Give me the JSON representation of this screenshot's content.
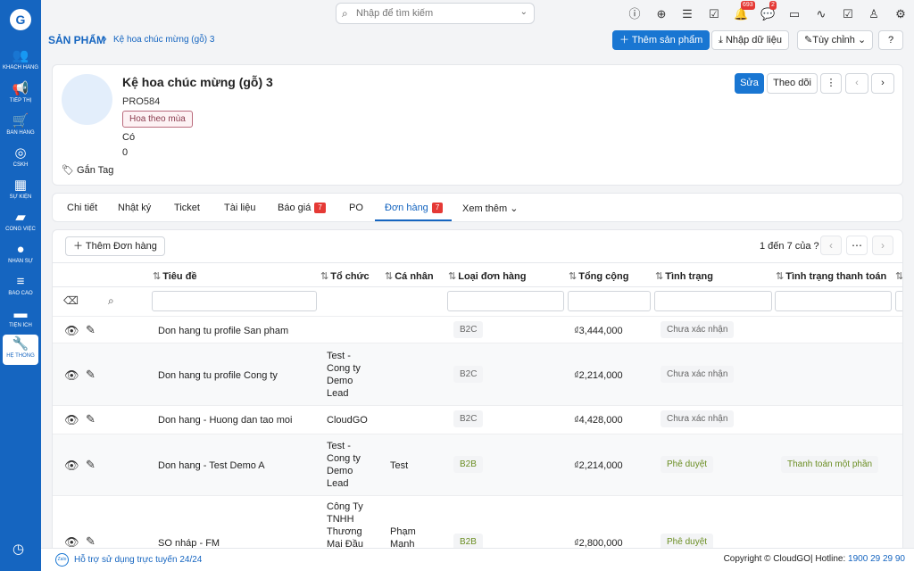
{
  "sidebar": {
    "logo": "G",
    "items": [
      {
        "label": "KHÁCH HÀNG",
        "icon": "users-icon",
        "glyph": "👥"
      },
      {
        "label": "TIẾP THỊ",
        "icon": "megaphone-icon",
        "glyph": "📢"
      },
      {
        "label": "BÁN HÀNG",
        "icon": "cart-icon",
        "glyph": "🛒"
      },
      {
        "label": "CSKH",
        "icon": "support-icon",
        "glyph": "◎"
      },
      {
        "label": "SỰ KIỆN",
        "icon": "calendar-icon",
        "glyph": "▦"
      },
      {
        "label": "CÔNG VIỆC",
        "icon": "briefcase-icon",
        "glyph": "▰"
      },
      {
        "label": "NHÂN SỰ",
        "icon": "person-icon",
        "glyph": "●"
      },
      {
        "label": "BÁO CÁO",
        "icon": "report-icon",
        "glyph": "≡"
      },
      {
        "label": "TIỆN ÍCH",
        "icon": "utility-icon",
        "glyph": "▬"
      },
      {
        "label": "HỆ THỐNG",
        "icon": "wrench-icon",
        "glyph": "🔧"
      }
    ]
  },
  "search": {
    "placeholder": "Nhập để tìm kiếm"
  },
  "topbar": {
    "notifications_badge": "693",
    "messages_badge": "2"
  },
  "breadcrumb": {
    "root": "Sản phẩm",
    "separator": "›",
    "current": "Kệ hoa chúc mừng (gỗ) 3"
  },
  "header_actions": {
    "add_product": "Thêm sản phẩm",
    "import": "Nhập dữ liệu",
    "customize": "Tùy chỉnh",
    "help": "?"
  },
  "product": {
    "name": "Kệ hoa chúc mừng (gỗ) 3",
    "code": "PRO584",
    "tag": "Hoa theo mùa",
    "field_co": "Có",
    "field_zero": "0",
    "add_tag": "Gắn Tag",
    "edit": "Sửa",
    "follow": "Theo dõi",
    "more": "⋮"
  },
  "tabs": [
    {
      "label": "Chi tiết"
    },
    {
      "label": "Nhật ký"
    },
    {
      "label": "Ticket"
    },
    {
      "label": "Tài liệu"
    },
    {
      "label": "Báo giá",
      "badge": "7"
    },
    {
      "label": "PO"
    },
    {
      "label": "Đơn hàng",
      "badge": "7"
    },
    {
      "label": "Xem thêm"
    }
  ],
  "orders": {
    "add_button": "Thêm Đơn hàng",
    "pager": "1 đến 7 của ?",
    "columns": [
      "Tiêu đề",
      "Tổ chức",
      "Cá nhân",
      "Loại đơn hàng",
      "Tổng cộng",
      "Tình trạng",
      "Tình trạng thanh toán"
    ],
    "rows": [
      {
        "title": "Don hang tu profile San pham",
        "org": "",
        "person": "",
        "type": "B2C",
        "total": "₫3,444,000",
        "status": "Chưa xác nhận",
        "payment": ""
      },
      {
        "title": "Don hang tu profile Cong ty",
        "org": "Test - Cong ty Demo Lead",
        "person": "",
        "type": "B2C",
        "total": "₫2,214,000",
        "status": "Chưa xác nhận",
        "payment": ""
      },
      {
        "title": "Don hang - Huong dan tao moi",
        "org": "CloudGO",
        "person": "",
        "type": "B2C",
        "total": "₫4,428,000",
        "status": "Chưa xác nhận",
        "payment": ""
      },
      {
        "title": "Don hang - Test Demo A",
        "org": "Test - Cong ty Demo Lead",
        "person": "Test",
        "type": "B2B",
        "total": "₫2,214,000",
        "status": "Phê duyệt",
        "payment": "Thanh toán một phần"
      },
      {
        "title": "SO nháp - FM",
        "org": "Công Ty TNHH Thương Mại Đầu",
        "person": "Phạm Mạnh",
        "type": "B2B",
        "total": "₫2,800,000",
        "status": "Phê duyệt",
        "payment": ""
      }
    ]
  },
  "footer": {
    "zalo": "Zalo",
    "support": "Hỗ trợ sử dụng trực tuyến 24/24",
    "copyright": "Copyright © CloudGO",
    "hotline_label": "| Hotline: ",
    "hotline": "1900 29 29 90"
  },
  "colors": {
    "primary": "#1565c0",
    "badge": "#e53935",
    "sidebar": "#1565c0"
  }
}
